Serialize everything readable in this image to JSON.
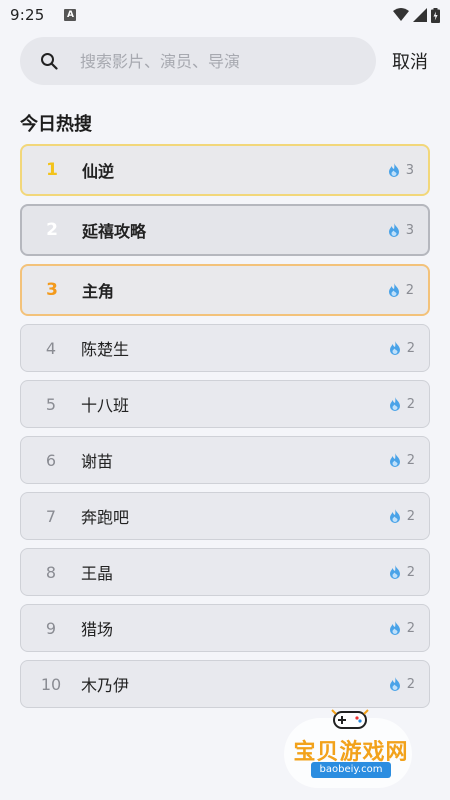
{
  "status_bar": {
    "time": "9:25",
    "notification_badge": "A"
  },
  "search": {
    "placeholder": "搜索影片、演员、导演",
    "value": "",
    "cancel_label": "取消"
  },
  "section_title": "今日热搜",
  "hot_list": [
    {
      "rank": "1",
      "title": "仙逆",
      "heat": "3"
    },
    {
      "rank": "2",
      "title": "延禧攻略",
      "heat": "3"
    },
    {
      "rank": "3",
      "title": "主角",
      "heat": "2"
    },
    {
      "rank": "4",
      "title": "陈楚生",
      "heat": "2"
    },
    {
      "rank": "5",
      "title": "十八班",
      "heat": "2"
    },
    {
      "rank": "6",
      "title": "谢苗",
      "heat": "2"
    },
    {
      "rank": "7",
      "title": "奔跑吧",
      "heat": "2"
    },
    {
      "rank": "8",
      "title": "王晶",
      "heat": "2"
    },
    {
      "rank": "9",
      "title": "猎场",
      "heat": "2"
    },
    {
      "rank": "10",
      "title": "木乃伊",
      "heat": "2"
    }
  ],
  "watermark": {
    "text": "宝贝游戏网",
    "url": "baobeiy.com"
  },
  "colors": {
    "rank1": "#f3c31b",
    "rank3": "#f39a1c",
    "flame": "#4aa3e8",
    "watermark": "#f2a21b"
  }
}
